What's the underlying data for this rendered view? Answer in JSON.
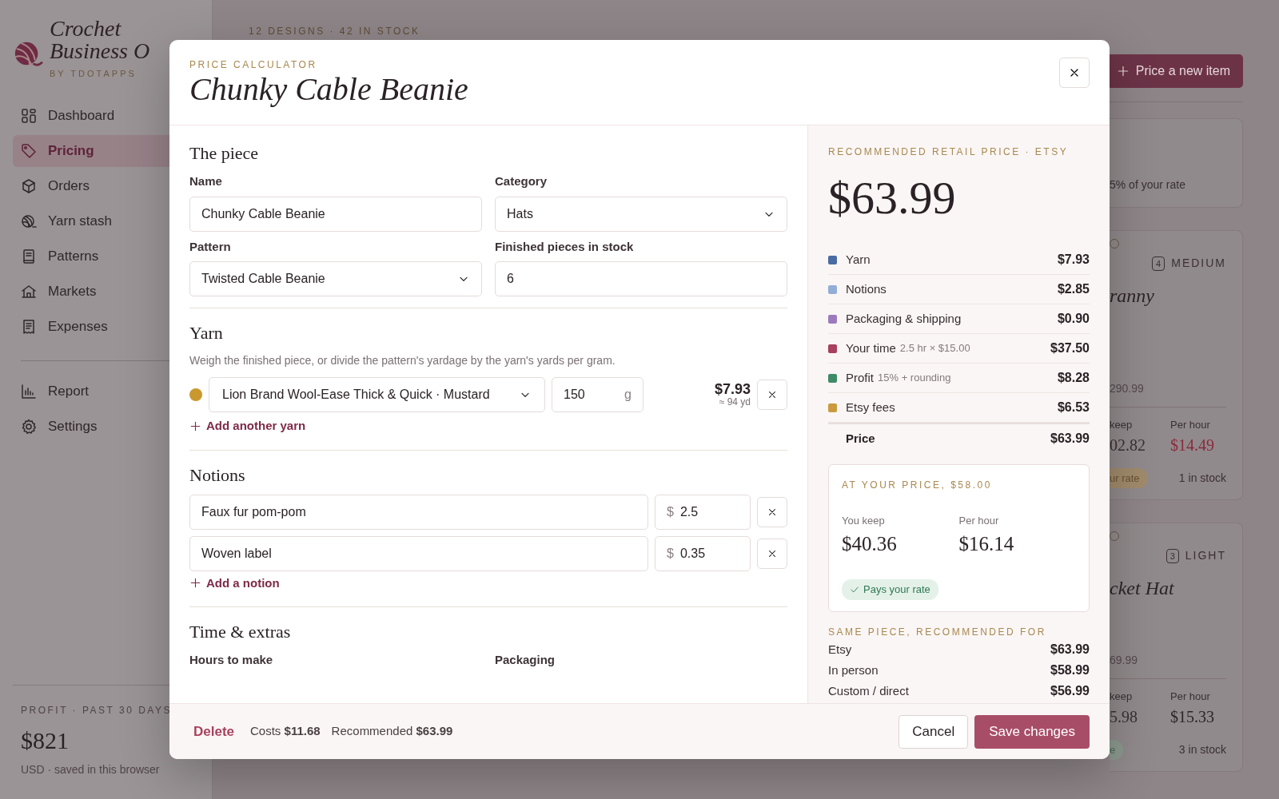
{
  "sidebar": {
    "brand": {
      "lines": [
        "Crochet",
        "Business O"
      ],
      "byline": "BY TDOTAPPS"
    },
    "nav": [
      {
        "label": "Dashboard",
        "selected": false
      },
      {
        "label": "Pricing",
        "selected": true
      },
      {
        "label": "Orders",
        "selected": false
      },
      {
        "label": "Yarn stash",
        "selected": false
      },
      {
        "label": "Patterns",
        "selected": false
      },
      {
        "label": "Markets",
        "selected": false
      },
      {
        "label": "Expenses",
        "selected": false
      }
    ],
    "nav_secondary": [
      {
        "label": "Report",
        "selected": false
      },
      {
        "label": "Settings",
        "selected": false
      }
    ],
    "footer": {
      "label": "PROFIT · PAST 30 DAYS",
      "value": "$821",
      "note": "USD · saved in this browser"
    }
  },
  "page": {
    "eyebrow": "12 DESIGNS · 42 IN STOCK",
    "new_button": "Price a new item",
    "cards": [
      {
        "kind": "note",
        "text": "5% of your rate"
      },
      {
        "kind": "design",
        "weight_number": "4",
        "weight": "MEDIUM",
        "title": "ranny",
        "price": "290.99",
        "keep_label": "keep",
        "keep": "02.82",
        "hour_label": "Per hour",
        "hour": "$14.49",
        "pays_rate": false,
        "badge": "ur rate",
        "stock": "1 in stock"
      },
      {
        "kind": "design",
        "weight_number": "3",
        "weight": "LIGHT",
        "title": "cket Hat",
        "price": "69.99",
        "keep_label": "keep",
        "keep": "5.98",
        "hour_label": "Per hour",
        "hour": "$15.33",
        "pays_rate": true,
        "badge": "e",
        "stock": "3 in stock"
      }
    ]
  },
  "modal": {
    "eyebrow": "PRICE CALCULATOR",
    "title": "Chunky Cable Beanie",
    "piece": {
      "heading": "The piece",
      "fields": [
        {
          "label": "Name",
          "kind": "text",
          "value": "Chunky Cable Beanie"
        },
        {
          "label": "Category",
          "kind": "select",
          "value": "Hats"
        },
        {
          "label": "Pattern",
          "kind": "select",
          "value": "Twisted Cable Beanie"
        },
        {
          "label": "Finished pieces in stock",
          "kind": "text",
          "value": "6"
        }
      ]
    },
    "yarn": {
      "heading": "Yarn",
      "hint": "Weigh the finished piece, or divide the pattern's yardage by the yarn's yards per gram.",
      "rows": [
        {
          "color": "#c9982e",
          "value": "Lion Brand Wool-Ease Thick & Quick · Mustard",
          "grams": "150",
          "unit": "g",
          "cost": "$7.93",
          "yardage": "≈ 94 yd"
        }
      ],
      "add": "Add another yarn"
    },
    "notions": {
      "heading": "Notions",
      "rows": [
        {
          "name": "Faux fur pom-pom",
          "currency": "$",
          "price": "2.5"
        },
        {
          "name": "Woven label",
          "currency": "$",
          "price": "0.35"
        }
      ],
      "add": "Add a notion"
    },
    "time": {
      "heading": "Time & extras",
      "labels": [
        "Hours to make",
        "Packaging"
      ]
    },
    "summary": {
      "eyebrow": "RECOMMENDED RETAIL PRICE · ETSY",
      "price": "$63.99",
      "breakdown": [
        {
          "label": "Yarn",
          "amount": "$7.93",
          "color": "#4a6aa3"
        },
        {
          "label": "Notions",
          "amount": "$2.85",
          "color": "#93aed6"
        },
        {
          "label": "Packaging & shipping",
          "amount": "$0.90",
          "color": "#9c7bbd"
        },
        {
          "label": "Your time",
          "detail": "2.5 hr × $15.00",
          "amount": "$37.50",
          "color": "#a8405f"
        },
        {
          "label": "Profit",
          "detail": "15% + rounding",
          "amount": "$8.28",
          "color": "#3f8a67"
        },
        {
          "label": "Etsy fees",
          "amount": "$6.53",
          "color": "#c99a3e"
        }
      ],
      "total": {
        "label": "Price",
        "amount": "$63.99"
      },
      "at_price": {
        "title": "AT YOUR PRICE, $58.00",
        "stats": [
          {
            "label": "You keep",
            "value": "$40.36"
          },
          {
            "label": "Per hour",
            "value": "$16.14"
          }
        ],
        "badge": {
          "kind": "pays",
          "text": "Pays your rate"
        }
      },
      "channels": {
        "title": "SAME PIECE, RECOMMENDED FOR",
        "rows": [
          {
            "label": "Etsy",
            "amount": "$63.99"
          },
          {
            "label": "In person",
            "amount": "$58.99"
          },
          {
            "label": "Custom / direct",
            "amount": "$56.99"
          }
        ]
      }
    },
    "footer": {
      "delete": "Delete",
      "costs": "Costs **$11.68**",
      "recommended": "Recommended **$63.99**",
      "cancel": "Cancel",
      "save": "Save changes"
    }
  }
}
